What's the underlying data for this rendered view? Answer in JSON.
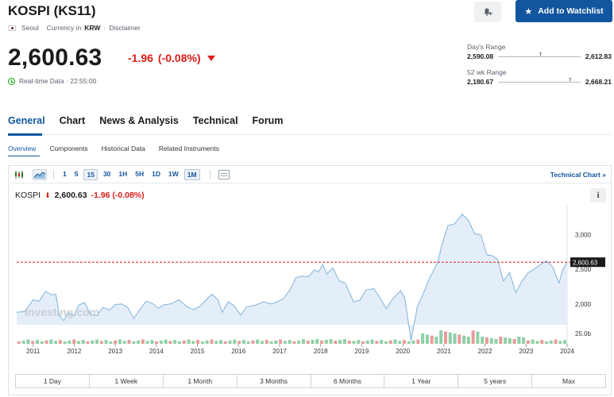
{
  "header": {
    "title": "KOSPI (KS11)",
    "exchange": "Seoul",
    "currency_prefix": "Currency in",
    "currency": "KRW",
    "disclaimer": "Disclaimer",
    "watchlist_label": "Add to Watchlist"
  },
  "quote": {
    "price": "2,600.63",
    "change": "-1.96",
    "change_pct": "(-0.08%)",
    "realtime": "Real-time Data · 22:55:00"
  },
  "ranges": {
    "day_label": "Day's Range",
    "day_low": "2,590.08",
    "day_high": "2,612.83",
    "day_position": 0.5,
    "week_label": "52 wk Range",
    "week_low": "2,180.67",
    "week_high": "2,668.21",
    "week_position": 0.86
  },
  "tabs": [
    "General",
    "Chart",
    "News & Analysis",
    "Technical",
    "Forum"
  ],
  "subtabs": [
    "Overview",
    "Components",
    "Historical Data",
    "Related Instruments"
  ],
  "toolbar": {
    "timeframes": [
      "1",
      "5",
      "15",
      "30",
      "1H",
      "5H",
      "1D",
      "1W",
      "1M"
    ],
    "selected": [
      "15",
      "1M"
    ],
    "technical_chart": "Technical Chart »"
  },
  "legend": {
    "symbol": "KOSPI",
    "price": "2,600.63",
    "change": "-1.96 (-0.08%)"
  },
  "periods": [
    "1 Day",
    "1 Week",
    "1 Month",
    "3 Months",
    "6 Months",
    "1 Year",
    "5 years",
    "Max"
  ],
  "colors": {
    "accent": "#1256a0",
    "negative": "#d91e18",
    "line": "#7fb3dc",
    "area": "#e4eef8",
    "vol_up": "#8fd0a6",
    "vol_down": "#e99a9a"
  },
  "chart_data": {
    "type": "area",
    "x_ticks": [
      "2011",
      "2012",
      "2013",
      "2014",
      "2015",
      "2016",
      "2017",
      "2018",
      "2019",
      "2020",
      "2021",
      "2022",
      "2023",
      "2024"
    ],
    "y_ticks": [
      "3,000",
      "2,500",
      "2,000"
    ],
    "y_tick_values": [
      3000,
      2500,
      2000
    ],
    "volume_label": "25.0b",
    "last_value_label": "2,600.63",
    "last_value": 2600.63,
    "watermark": "Investing.com",
    "x_range": [
      2010.6,
      2024.0
    ],
    "y_range": [
      1700,
      3300
    ],
    "points": [
      [
        2010.6,
        1880
      ],
      [
        2010.8,
        1890
      ],
      [
        2011.0,
        2060
      ],
      [
        2011.15,
        2040
      ],
      [
        2011.3,
        2180
      ],
      [
        2011.45,
        2130
      ],
      [
        2011.55,
        2140
      ],
      [
        2011.65,
        1820
      ],
      [
        2011.75,
        1760
      ],
      [
        2011.85,
        1880
      ],
      [
        2012.0,
        1830
      ],
      [
        2012.1,
        1980
      ],
      [
        2012.25,
        2020
      ],
      [
        2012.4,
        1850
      ],
      [
        2012.55,
        1830
      ],
      [
        2012.7,
        1950
      ],
      [
        2012.85,
        1910
      ],
      [
        2013.0,
        1990
      ],
      [
        2013.15,
        2000
      ],
      [
        2013.3,
        1950
      ],
      [
        2013.45,
        1790
      ],
      [
        2013.6,
        1920
      ],
      [
        2013.75,
        2040
      ],
      [
        2013.9,
        2010
      ],
      [
        2014.05,
        1940
      ],
      [
        2014.2,
        1990
      ],
      [
        2014.35,
        2000
      ],
      [
        2014.55,
        2060
      ],
      [
        2014.75,
        1960
      ],
      [
        2014.9,
        1920
      ],
      [
        2015.05,
        1960
      ],
      [
        2015.2,
        2050
      ],
      [
        2015.35,
        2140
      ],
      [
        2015.5,
        2060
      ],
      [
        2015.6,
        1880
      ],
      [
        2015.75,
        2030
      ],
      [
        2015.9,
        1970
      ],
      [
        2016.05,
        1840
      ],
      [
        2016.2,
        1960
      ],
      [
        2016.4,
        1980
      ],
      [
        2016.6,
        2030
      ],
      [
        2016.8,
        2000
      ],
      [
        2016.95,
        2030
      ],
      [
        2017.1,
        2080
      ],
      [
        2017.25,
        2200
      ],
      [
        2017.4,
        2380
      ],
      [
        2017.55,
        2400
      ],
      [
        2017.7,
        2390
      ],
      [
        2017.85,
        2490
      ],
      [
        2017.95,
        2460
      ],
      [
        2018.05,
        2570
      ],
      [
        2018.15,
        2430
      ],
      [
        2018.3,
        2520
      ],
      [
        2018.45,
        2330
      ],
      [
        2018.6,
        2300
      ],
      [
        2018.8,
        2030
      ],
      [
        2018.95,
        2050
      ],
      [
        2019.1,
        2200
      ],
      [
        2019.3,
        2220
      ],
      [
        2019.45,
        2080
      ],
      [
        2019.6,
        1930
      ],
      [
        2019.75,
        2070
      ],
      [
        2019.95,
        2190
      ],
      [
        2020.05,
        2080
      ],
      [
        2020.2,
        1470
      ],
      [
        2020.35,
        1950
      ],
      [
        2020.5,
        2150
      ],
      [
        2020.65,
        2370
      ],
      [
        2020.85,
        2600
      ],
      [
        2020.95,
        2850
      ],
      [
        2021.1,
        3130
      ],
      [
        2021.25,
        3150
      ],
      [
        2021.45,
        3290
      ],
      [
        2021.6,
        3200
      ],
      [
        2021.75,
        3010
      ],
      [
        2021.9,
        2990
      ],
      [
        2022.05,
        2700
      ],
      [
        2022.15,
        2700
      ],
      [
        2022.3,
        2650
      ],
      [
        2022.45,
        2330
      ],
      [
        2022.6,
        2450
      ],
      [
        2022.75,
        2160
      ],
      [
        2022.9,
        2330
      ],
      [
        2023.05,
        2450
      ],
      [
        2023.2,
        2500
      ],
      [
        2023.35,
        2570
      ],
      [
        2023.5,
        2620
      ],
      [
        2023.65,
        2530
      ],
      [
        2023.8,
        2300
      ],
      [
        2023.9,
        2500
      ],
      [
        2024.0,
        2600
      ]
    ]
  }
}
